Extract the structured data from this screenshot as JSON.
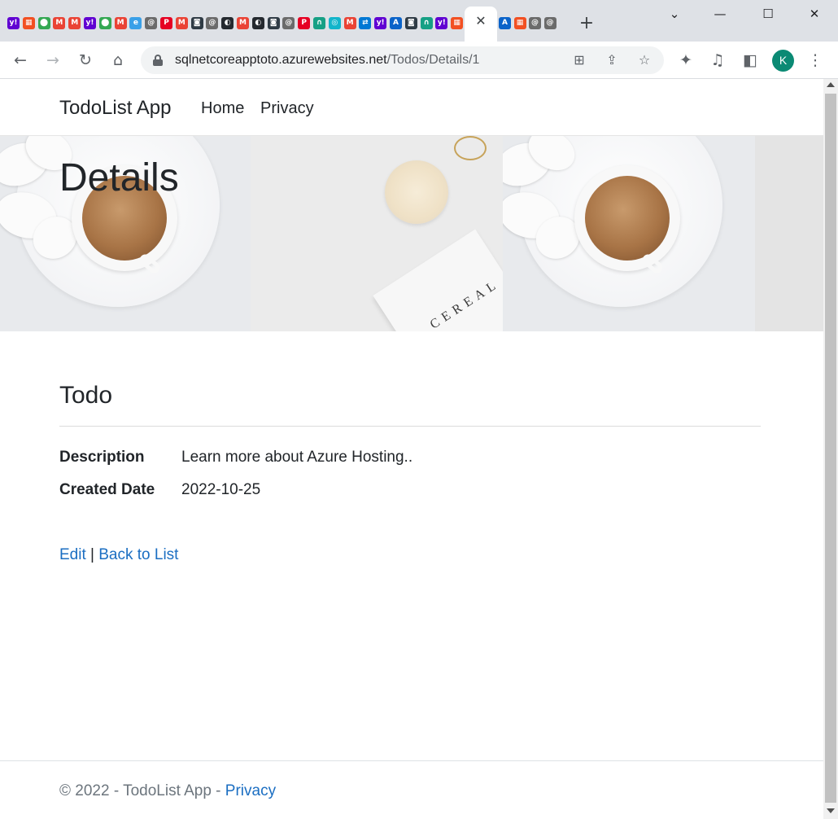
{
  "browser": {
    "tab_favicons": [
      {
        "icon": "yahoo-mail-icon",
        "bg": "#6001d2",
        "glyph": "y!"
      },
      {
        "icon": "microsoft-icon",
        "bg": "#f25022",
        "glyph": "▦"
      },
      {
        "icon": "google-maps-icon",
        "bg": "#34a853",
        "glyph": "⬤"
      },
      {
        "icon": "gmail-icon",
        "bg": "#ea4335",
        "glyph": "M"
      },
      {
        "icon": "gmail-icon",
        "bg": "#ea4335",
        "glyph": "M"
      },
      {
        "icon": "yahoo-mail-icon",
        "bg": "#6001d2",
        "glyph": "y!"
      },
      {
        "icon": "google-maps-icon",
        "bg": "#34a853",
        "glyph": "⬤"
      },
      {
        "icon": "gmail-icon",
        "bg": "#ea4335",
        "glyph": "M"
      },
      {
        "icon": "edge-icon",
        "bg": "#3aa0e8",
        "glyph": "e"
      },
      {
        "icon": "grey-site-icon",
        "bg": "#6b6b6b",
        "glyph": "@"
      },
      {
        "icon": "pinterest-icon",
        "bg": "#e60023",
        "glyph": "P"
      },
      {
        "icon": "gmail-icon",
        "bg": "#ea4335",
        "glyph": "M"
      },
      {
        "icon": "dark-site-icon",
        "bg": "#2f3b45",
        "glyph": "◙"
      },
      {
        "icon": "grey-site-icon",
        "bg": "#6b6b6b",
        "glyph": "@"
      },
      {
        "icon": "github-icon",
        "bg": "#24292f",
        "glyph": "◐"
      },
      {
        "icon": "gmail-icon",
        "bg": "#ea4335",
        "glyph": "M"
      },
      {
        "icon": "github-icon",
        "bg": "#24292f",
        "glyph": "◐"
      },
      {
        "icon": "dark-site-icon",
        "bg": "#2f3b45",
        "glyph": "◙"
      },
      {
        "icon": "grey-site-icon",
        "bg": "#6b6b6b",
        "glyph": "@"
      },
      {
        "icon": "pinterest-icon",
        "bg": "#e60023",
        "glyph": "P"
      },
      {
        "icon": "green-site-icon",
        "bg": "#16a085",
        "glyph": "∩"
      },
      {
        "icon": "teal-site-icon",
        "bg": "#12b5cb",
        "glyph": "◎"
      },
      {
        "icon": "gmail-icon",
        "bg": "#ea4335",
        "glyph": "M"
      },
      {
        "icon": "azure-devops-icon",
        "bg": "#0078d4",
        "glyph": "⇄"
      },
      {
        "icon": "yahoo-mail-icon",
        "bg": "#6001d2",
        "glyph": "y!"
      },
      {
        "icon": "azure-icon",
        "bg": "#0a63c9",
        "glyph": "A"
      },
      {
        "icon": "dark-site-icon",
        "bg": "#2f3b45",
        "glyph": "◙"
      },
      {
        "icon": "green-site-icon",
        "bg": "#16a085",
        "glyph": "∩"
      },
      {
        "icon": "yahoo-mail-icon",
        "bg": "#6001d2",
        "glyph": "y!"
      },
      {
        "icon": "microsoft-icon",
        "bg": "#f25022",
        "glyph": "▦"
      }
    ],
    "tab_favicons_after": [
      {
        "icon": "azure-icon",
        "bg": "#0a63c9",
        "glyph": "A"
      },
      {
        "icon": "microsoft-icon",
        "bg": "#f25022",
        "glyph": "▦"
      },
      {
        "icon": "grey-site-icon",
        "bg": "#6b6b6b",
        "glyph": "@"
      },
      {
        "icon": "grey-site-icon",
        "bg": "#6b6b6b",
        "glyph": "@"
      }
    ],
    "close_tab_glyph": "✕",
    "new_tab_glyph": "+",
    "window_controls": {
      "tab_search": "⌄",
      "minimize": "—",
      "maximize": "☐",
      "close": "✕"
    },
    "toolbar": {
      "back": "←",
      "forward": "→",
      "reload": "↻",
      "home": "⌂"
    },
    "url_host": "sqlnetcoreapptoto.azurewebsites.net",
    "url_path": "/Todos/Details/1",
    "omnibox_icons": {
      "translate": "⊞",
      "share": "⇪",
      "bookmark": "☆"
    },
    "right_icons": {
      "extensions": "✦",
      "media": "♫",
      "side_panel": "◧",
      "menu": "⋮"
    },
    "profile_initial": "K"
  },
  "nav": {
    "brand": "TodoList App",
    "links": [
      "Home",
      "Privacy"
    ]
  },
  "hero": {
    "title": "Details",
    "card_text": "CEREAL"
  },
  "todo": {
    "heading": "Todo",
    "fields": [
      {
        "label": "Description",
        "value": "Learn more about Azure Hosting.."
      },
      {
        "label": "Created Date",
        "value": "2022-10-25"
      }
    ],
    "actions": {
      "edit": "Edit",
      "separator": "|",
      "back": "Back to List"
    }
  },
  "footer": {
    "text": "© 2022 - TodoList App - ",
    "privacy_link": "Privacy"
  }
}
